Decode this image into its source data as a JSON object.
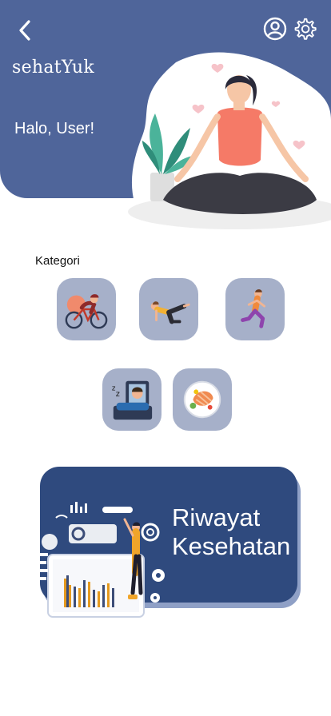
{
  "header": {
    "app_name": "sehatYuk",
    "greeting": "Halo, User!"
  },
  "icons": {
    "back": "back-arrow-icon",
    "profile": "user-circle-icon",
    "settings": "gear-icon"
  },
  "categories": {
    "title": "Kategori",
    "items": [
      {
        "name": "cycling",
        "icon": "cyclist-icon"
      },
      {
        "name": "exercise",
        "icon": "stretching-icon"
      },
      {
        "name": "running",
        "icon": "runner-icon"
      },
      {
        "name": "sleep",
        "icon": "sleeping-person-icon"
      },
      {
        "name": "food",
        "icon": "healthy-food-icon"
      }
    ]
  },
  "history_card": {
    "line1": "Riwayat",
    "line2": "Kesehatan"
  },
  "colors": {
    "primary": "#4f659a",
    "card": "#2f4a7e",
    "tile": "#a6b0c9"
  }
}
